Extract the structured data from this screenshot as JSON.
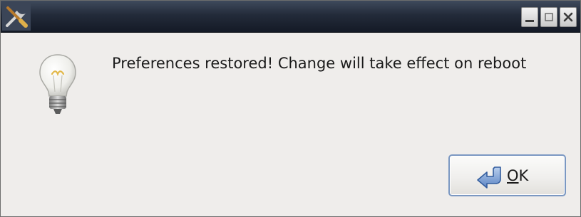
{
  "window": {
    "title": "",
    "controls": [
      "minimize",
      "maximize",
      "close"
    ]
  },
  "dialog": {
    "icon": "lightbulb-icon",
    "message": "Preferences restored! Change will take effect on reboot"
  },
  "ok_button": {
    "icon": "return-arrow-icon",
    "mnemonic": "O",
    "label_rest": "K"
  },
  "colors": {
    "titlebar": "#1c2330",
    "background": "#efedeb",
    "button_border": "#7b98c2"
  }
}
